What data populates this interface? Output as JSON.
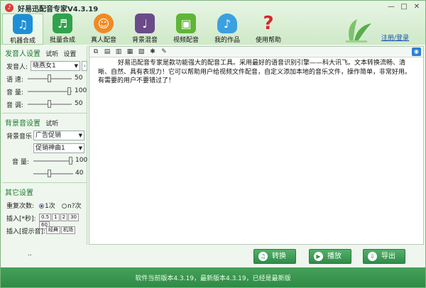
{
  "window": {
    "title": "好易迅配音专家V4.3.19",
    "logo_char": "♪",
    "min": "—",
    "max": "□",
    "close": "✕"
  },
  "toolbar": [
    {
      "label": "机器合成",
      "icon": "music-note-icon",
      "color": "#1e8fd6",
      "glyph": "♫"
    },
    {
      "label": "批量合成",
      "icon": "batch-icon",
      "color": "#31a24c",
      "glyph": "♬"
    },
    {
      "label": "真人配音",
      "icon": "person-icon",
      "color": "#f08a24",
      "glyph": "☺"
    },
    {
      "label": "背景混音",
      "icon": "piano-icon",
      "color": "#6b4a8a",
      "glyph": "♩"
    },
    {
      "label": "视频配音",
      "icon": "film-icon",
      "color": "#5fb636",
      "glyph": "▣"
    },
    {
      "label": "我的作品",
      "icon": "note-drop-icon",
      "color": "#3aa0e0",
      "glyph": "♪"
    },
    {
      "label": "使用帮助",
      "icon": "question-icon",
      "color": "#d8262d",
      "glyph": "?"
    }
  ],
  "login": "注册/登录",
  "speaker": {
    "title": "发音人设置",
    "try_label": "试听",
    "settings_label": "设置",
    "speaker_label": "发音人:",
    "speaker_value": "晓燕女1",
    "speed_label": "语 速:",
    "speed_value": "50",
    "speed_level": 0.5,
    "volume_label": "音 量:",
    "volume_value": "100",
    "volume_level": 1.0,
    "pitch_label": "音 调:",
    "pitch_value": "50",
    "pitch_level": 0.5
  },
  "bgm": {
    "title": "背景音设置",
    "try_label": "试听",
    "music_label": "背景音乐",
    "category_value": "广告促销",
    "track_value": "促销神曲1",
    "volume_label": "音 量:",
    "volume_value": "100",
    "volume_level": 1.0,
    "balance_value": "40",
    "balance_level": 0.4
  },
  "other": {
    "title": "其它设置",
    "repeat_label": "重复次数:",
    "once": "1次",
    "ntimes": "n?次",
    "insert_label": "插入[*秒]:",
    "insert_options": [
      "0.5",
      "1",
      "2",
      "30",
      "60"
    ],
    "hint_label": "插入[提示音]:",
    "hint_options": [
      "经典",
      "机场"
    ]
  },
  "editor": {
    "camera_icon": "◉",
    "text": "好易迅配音专家是款功能强大的配音工具。采用最好的语音识别引擎——科大讯飞。文本转换流畅、清晰、自然、具有表现力！它可以帮助用户给视频文件配音，自定义添加本地的音乐文件，操作简单，非常好用。有需要的用户不要错过了！"
  },
  "bottom": {
    "dots": "..",
    "convert": "转换",
    "play": "播放",
    "export": "导出",
    "convert_glyph": "♫",
    "play_glyph": "▶",
    "export_glyph": "⇩"
  },
  "status": "软件当前版本4.3.19，最新版本4.3.19，已经是最新版"
}
